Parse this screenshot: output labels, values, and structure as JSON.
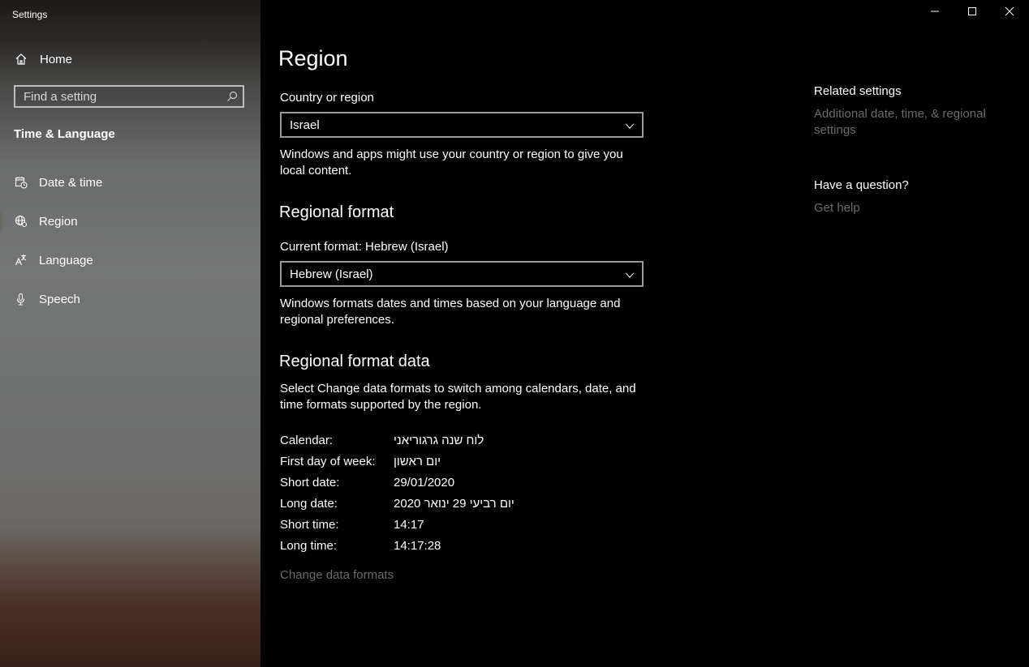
{
  "window": {
    "app_title": "Settings",
    "controls": [
      "minimize-icon",
      "maximize-icon",
      "close-icon"
    ]
  },
  "sidebar": {
    "home_label": "Home",
    "search_placeholder": "Find a setting",
    "section_title": "Time & Language",
    "items": [
      {
        "label": "Date & time",
        "icon": "calendar-clock-icon"
      },
      {
        "label": "Region",
        "icon": "globe-region-icon",
        "selected": true
      },
      {
        "label": "Language",
        "icon": "language-icon"
      },
      {
        "label": "Speech",
        "icon": "microphone-icon"
      }
    ]
  },
  "main": {
    "title": "Region",
    "country": {
      "label": "Country or region",
      "value": "Israel",
      "description": "Windows and apps might use your country or region to give you local content."
    },
    "regional_format": {
      "heading": "Regional format",
      "current_label": "Current format: Hebrew (Israel)",
      "value": "Hebrew (Israel)",
      "description": "Windows formats dates and times based on your language and regional preferences."
    },
    "regional_format_data": {
      "heading": "Regional format data",
      "description": "Select Change data formats to switch among calendars, date, and time formats supported by the region.",
      "rows": [
        {
          "key": "Calendar:",
          "value": "לוח שנה גרגוריאני"
        },
        {
          "key": "First day of week:",
          "value": "יום ראשון"
        },
        {
          "key": "Short date:",
          "value": "29/01/2020"
        },
        {
          "key": "Long date:",
          "value": "יום רביעי 29 ינואר 2020"
        },
        {
          "key": "Short time:",
          "value": "14:17"
        },
        {
          "key": "Long time:",
          "value": "14:17:28"
        }
      ],
      "change_link": "Change data formats"
    }
  },
  "related": {
    "heading": "Related settings",
    "link": "Additional date, time, & regional settings",
    "question_heading": "Have a question?",
    "help_link": "Get help"
  },
  "colors": {
    "link_dim": "#6b6b6b",
    "background": "#000000"
  }
}
